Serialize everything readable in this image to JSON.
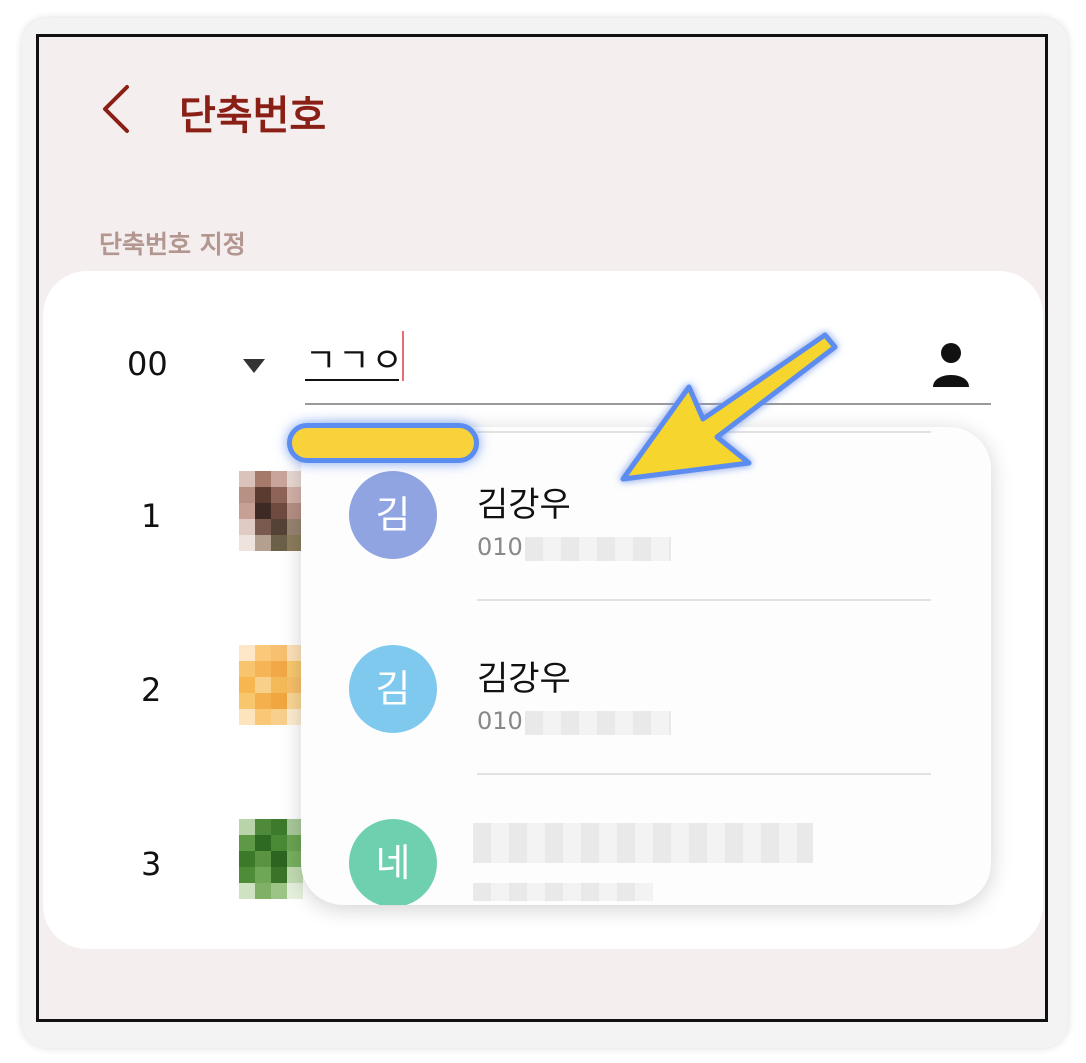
{
  "header": {
    "title": "단축번호"
  },
  "section": {
    "label": "단축번호 지정"
  },
  "input_row": {
    "slot": "00",
    "value": "ㄱㄱㅇ"
  },
  "slots": [
    {
      "number": "1"
    },
    {
      "number": "2"
    },
    {
      "number": "3"
    }
  ],
  "suggestions": [
    {
      "initial": "김",
      "name": "김강우",
      "phone_prefix": "010",
      "avatar_color": "#8fa4e0"
    },
    {
      "initial": "김",
      "name": "김강우",
      "phone_prefix": "010",
      "avatar_color": "#7fc8ee"
    },
    {
      "initial": "네",
      "name": "",
      "phone_prefix": "",
      "avatar_color": "#6fd0b0"
    }
  ],
  "colors": {
    "title": "#8a1f16",
    "highlight": "#f7d23a",
    "arrow": "#f5d52e",
    "outline": "#5b8cf0"
  },
  "icons": {
    "back": "chevron-left-icon",
    "contact": "person-icon",
    "dropdown": "triangle-down-icon"
  }
}
